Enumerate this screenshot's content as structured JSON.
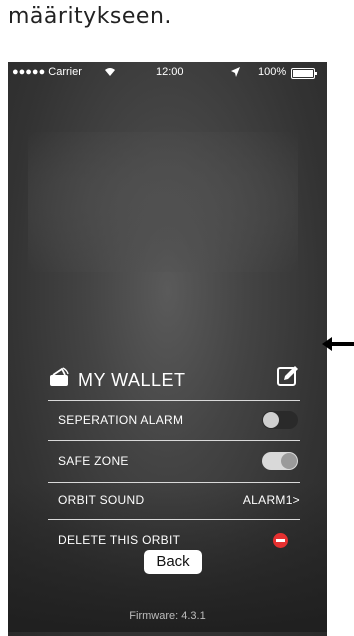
{
  "caption": "määritykseen.",
  "statusbar": {
    "carrier": "●●●●● Carrier",
    "time": "12:00",
    "battery": "100%"
  },
  "wallet": {
    "title": "MY WALLET"
  },
  "menu": {
    "separation_alarm": {
      "label": "SEPERATION ALARM",
      "enabled": false
    },
    "safe_zone": {
      "label": "SAFE ZONE",
      "enabled": true
    },
    "orbit_sound": {
      "label": "ORBIT SOUND",
      "value": "ALARM1>"
    },
    "delete": {
      "label": "DELETE THIS ORBIT"
    }
  },
  "back_label": "Back",
  "firmware": "Firmware: 4.3.1",
  "colors": {
    "delete_red": "#e53030",
    "toggle_on": "#d9d9d9",
    "toggle_off": "#2a2a2a"
  },
  "icons": {
    "wallet": "wallet-icon",
    "edit": "edit-icon",
    "delete": "minus-circle-icon",
    "wifi": "wifi-icon",
    "location": "location-arrow-icon",
    "battery": "battery-icon",
    "arrow": "arrow-left-icon"
  }
}
